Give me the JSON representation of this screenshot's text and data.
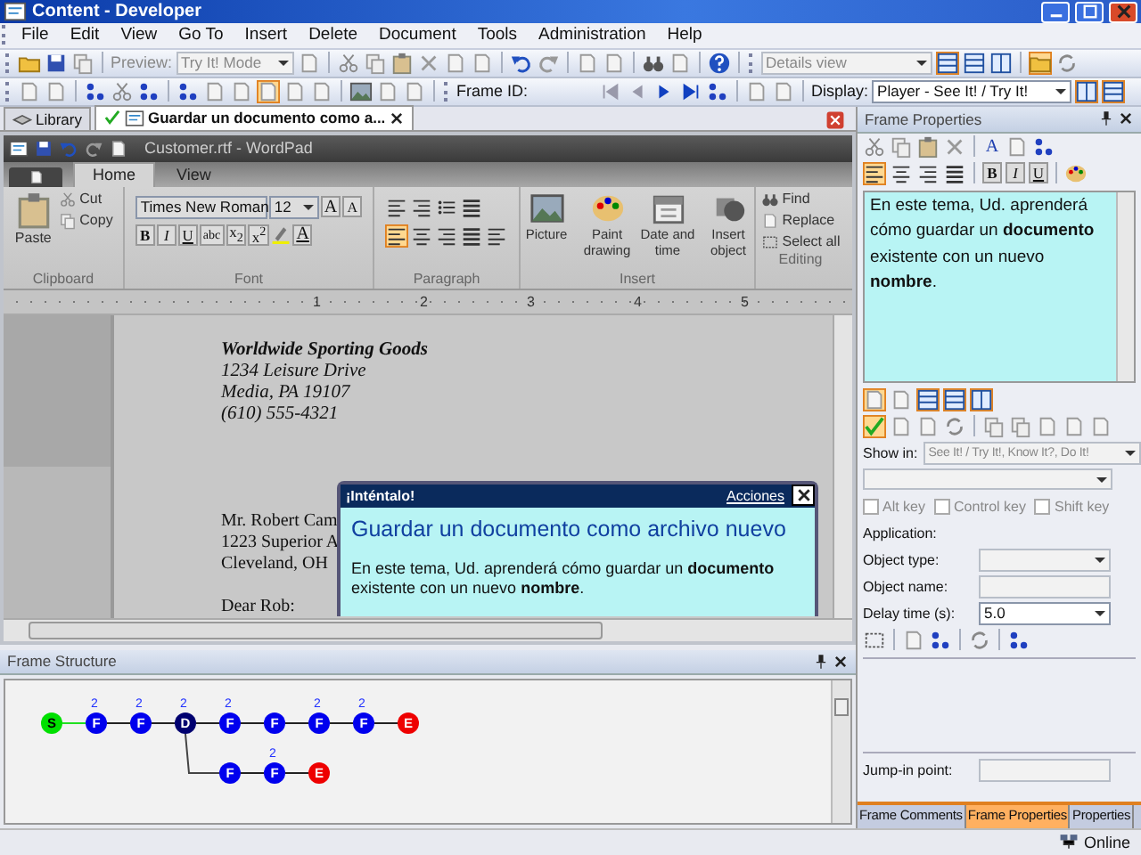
{
  "window": {
    "title": "Content - Developer"
  },
  "menu": [
    "File",
    "Edit",
    "View",
    "Go To",
    "Insert",
    "Delete",
    "Document",
    "Tools",
    "Administration",
    "Help"
  ],
  "toolbar": {
    "preview_label": "Preview:",
    "preview_mode": "Try It! Mode",
    "view_mode": "Details view",
    "frame_id_label": "Frame ID:",
    "display_label": "Display:",
    "display_mode": "Player - See It! / Try It!"
  },
  "doc_tabs": [
    {
      "label": "Library",
      "selected": false,
      "checked": false
    },
    {
      "label": "Guardar un documento como a...",
      "selected": true,
      "checked": true
    }
  ],
  "wordpad": {
    "title": "Customer.rtf - WordPad",
    "tabs": [
      {
        "label": "Home",
        "selected": true
      },
      {
        "label": "View",
        "selected": false
      }
    ],
    "clipboard": {
      "paste": "Paste",
      "cut": "Cut",
      "copy": "Copy",
      "label": "Clipboard"
    },
    "font": {
      "family": "Times New Roman",
      "size": "12",
      "size_buttons": [
        "A",
        "A"
      ],
      "format_buttons": [
        "B",
        "I",
        "U",
        "abc",
        "x$_{2}$",
        "x$^{2}$"
      ],
      "color_button": "A",
      "label": "Font"
    },
    "paragraph": {
      "label": "Paragraph"
    },
    "insert": {
      "items": [
        "Picture",
        "Paint drawing",
        "Date and time",
        "Insert object"
      ],
      "label": "Insert"
    },
    "editing": {
      "items": [
        "Find",
        "Replace",
        "Select all"
      ],
      "label": "Editing"
    },
    "ruler": [
      "1",
      "2",
      "3",
      "4",
      "5"
    ],
    "sender": [
      "Worldwide Sporting Goods",
      "1234 Leisure Drive",
      "Media, PA 19107",
      "(610) 555-4321"
    ],
    "recipient": [
      "Mr. Robert Cam",
      "1223 Superior A",
      "Cleveland, OH"
    ],
    "salutation": "Dear Rob:"
  },
  "bubble": {
    "header": "¡Inténtalo!",
    "link": "Acciones",
    "title": "Guardar un documento como archivo nuevo",
    "body": "En este tema, Ud. aprenderá cómo guardar un **documento** existente con un nuevo **nombre**."
  },
  "frame_structure": {
    "title": "Frame Structure",
    "main": [
      {
        "label": "S",
        "kind": "start"
      },
      {
        "label": "F",
        "kind": "frame",
        "badge": "2"
      },
      {
        "label": "F",
        "kind": "frame",
        "badge": "2"
      },
      {
        "label": "D",
        "kind": "decision",
        "badge": "2"
      },
      {
        "label": "F",
        "kind": "frame",
        "badge": "2"
      },
      {
        "label": "F",
        "kind": "frame"
      },
      {
        "label": "F",
        "kind": "frame",
        "badge": "2"
      },
      {
        "label": "F",
        "kind": "frame",
        "badge": "2"
      },
      {
        "label": "E",
        "kind": "end"
      }
    ],
    "branch": [
      {
        "label": "F",
        "kind": "frame"
      },
      {
        "label": "F",
        "kind": "frame",
        "badge": "2"
      },
      {
        "label": "E",
        "kind": "end"
      }
    ]
  },
  "frame_properties": {
    "title": "Frame Properties",
    "font_button": "A",
    "format_buttons": [
      "B",
      "I",
      "U"
    ],
    "text": "En este tema, Ud. aprenderá cómo guardar un **documento** existente con un nuevo **nombre**.",
    "show_in_label": "Show in:",
    "show_in": "See It! / Try It!, Know It?, Do It!",
    "keys": [
      {
        "label": "Alt key",
        "checked": false
      },
      {
        "label": "Control key",
        "checked": false
      },
      {
        "label": "Shift key",
        "checked": false
      }
    ],
    "application_label": "Application:",
    "object_type_label": "Object type:",
    "object_name_label": "Object name:",
    "delay_label": "Delay time (s):",
    "delay": "5.0",
    "jump_in_label": "Jump-in point:"
  },
  "panel_tabs": [
    {
      "label": "Frame Comments",
      "selected": false
    },
    {
      "label": "Frame Properties",
      "selected": true
    },
    {
      "label": "Properties",
      "selected": false
    }
  ],
  "status_bar": {
    "status": "Online"
  }
}
